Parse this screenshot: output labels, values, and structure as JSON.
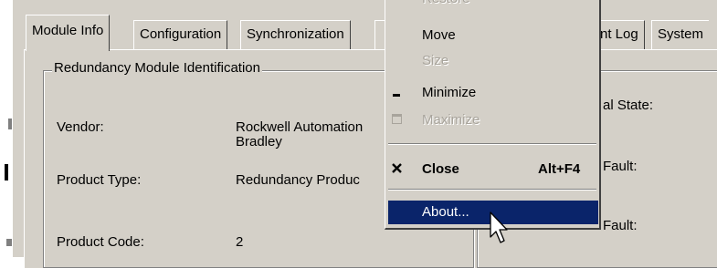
{
  "tabs": [
    {
      "label": "Module Info",
      "active": true
    },
    {
      "label": "Configuration",
      "active": false
    },
    {
      "label": "Synchronization",
      "active": false
    },
    {
      "label": "nt Log",
      "active": false
    },
    {
      "label": "System",
      "active": false
    }
  ],
  "identification": {
    "title": "Redundancy Module Identification",
    "vendor_label": "Vendor:",
    "vendor_value_line1": "Rockwell Automation",
    "vendor_value_line2": "Bradley",
    "product_type_label": "Product Type:",
    "product_type_value": "Redundancy Produc",
    "product_code_label": "Product Code:",
    "product_code_value": "2"
  },
  "status_fragments": {
    "state_label": "al State:",
    "fault_label_1": "Fault:",
    "fault_label_2": "Fault:"
  },
  "menu": {
    "restore": "Restore",
    "move": "Move",
    "size": "Size",
    "minimize": "Minimize",
    "maximize": "Maximize",
    "close": "Close",
    "close_shortcut": "Alt+F4",
    "about": "About..."
  },
  "colors": {
    "face": "#d4d0c8",
    "highlight": "#0a246a",
    "disabled_text": "#a8a49c"
  }
}
